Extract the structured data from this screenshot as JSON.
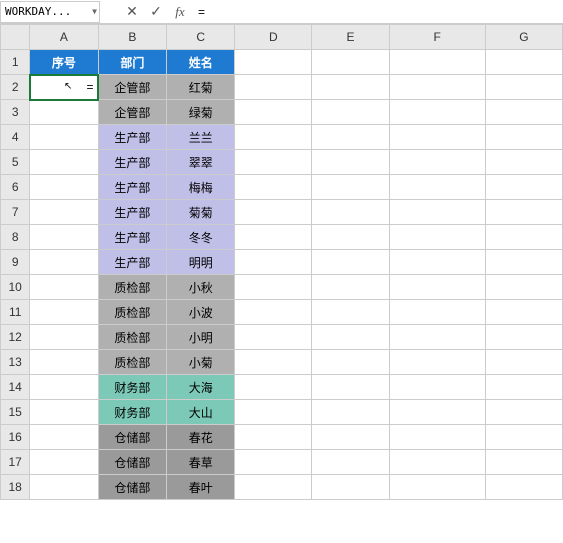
{
  "name_box": "WORKDAY...",
  "formula_value": "=",
  "columns": [
    "A",
    "B",
    "C",
    "D",
    "E",
    "F",
    "G"
  ],
  "row_numbers": [
    1,
    2,
    3,
    4,
    5,
    6,
    7,
    8,
    9,
    10,
    11,
    12,
    13,
    14,
    15,
    16,
    17,
    18
  ],
  "headers": {
    "a": "序号",
    "b": "部门",
    "c": "姓名"
  },
  "active_cell_value": "=",
  "chart_data": {
    "type": "table",
    "columns": [
      "序号",
      "部门",
      "姓名"
    ],
    "rows": [
      {
        "dept": "企管部",
        "name": "红菊",
        "group": 0
      },
      {
        "dept": "企管部",
        "name": "绿菊",
        "group": 0
      },
      {
        "dept": "生产部",
        "name": "兰兰",
        "group": 1
      },
      {
        "dept": "生产部",
        "name": "翠翠",
        "group": 1
      },
      {
        "dept": "生产部",
        "name": "梅梅",
        "group": 1
      },
      {
        "dept": "生产部",
        "name": "菊菊",
        "group": 1
      },
      {
        "dept": "生产部",
        "name": "冬冬",
        "group": 1
      },
      {
        "dept": "生产部",
        "name": "明明",
        "group": 1
      },
      {
        "dept": "质检部",
        "name": "小秋",
        "group": 2
      },
      {
        "dept": "质检部",
        "name": "小波",
        "group": 2
      },
      {
        "dept": "质检部",
        "name": "小明",
        "group": 2
      },
      {
        "dept": "质检部",
        "name": "小菊",
        "group": 2
      },
      {
        "dept": "财务部",
        "name": "大海",
        "group": 3
      },
      {
        "dept": "财务部",
        "name": "大山",
        "group": 3
      },
      {
        "dept": "仓储部",
        "name": "春花",
        "group": 4
      },
      {
        "dept": "仓储部",
        "name": "春草",
        "group": 4
      },
      {
        "dept": "仓储部",
        "name": "春叶",
        "group": 4
      }
    ]
  }
}
